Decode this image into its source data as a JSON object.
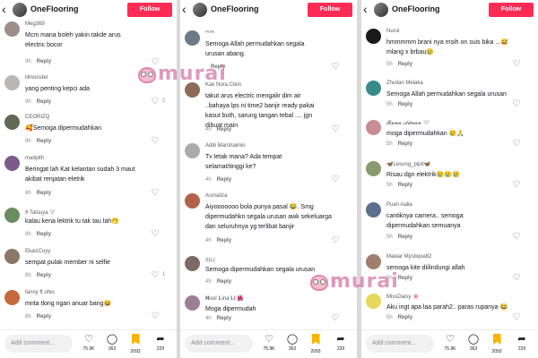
{
  "colors": {
    "follow_bg": "#fe2c55",
    "bookmark": "#f7b500",
    "watermark": "#d279a6"
  },
  "icons": {
    "back": "chevron-left-icon",
    "like": "heart-icon",
    "share": "share-icon",
    "save": "bookmark-icon",
    "comment": "comment-icon"
  },
  "watermark_text": "murai",
  "panels": [
    {
      "header": {
        "back": "‹",
        "name": "OneFlooring",
        "follow": "Follow"
      },
      "comments": [
        {
          "user": "Meg369",
          "text": "Mcm mana boleh yakin takde arus electric bocor",
          "time": "9h",
          "reply": "Reply",
          "likes": "",
          "avatar": "#9c8f8a"
        },
        {
          "user": "lilmonster",
          "text": "yang penting kepci ada",
          "time": "9h",
          "reply": "Reply",
          "likes": "2",
          "avatar": "#b9b7b5"
        },
        {
          "user": "CEORIZQ",
          "text": "🥰Semoga dipermudahkan",
          "time": "9h",
          "reply": "Reply",
          "likes": "",
          "avatar": "#5f6b54"
        },
        {
          "user": "madyith",
          "text": "Beringat lah Kat kelantan sudah 3 maut akibat renjatan eletrik",
          "time": "8h",
          "reply": "Reply",
          "likes": "",
          "avatar": "#7a5b8a"
        },
        {
          "user": "ϑ Tatsuya ツ",
          "text": "kalau kena lektrik tu tak tau lah🤭",
          "time": "8h",
          "reply": "Reply",
          "likes": "",
          "avatar": "#6a8c5e"
        },
        {
          "user": "EkaizCuyy",
          "text": "sempat pulak member ni selfie",
          "time": "8h",
          "reply": "Reply",
          "likes": "1",
          "avatar": "#8a7766"
        },
        {
          "user": "fanny ft ohio",
          "text": "mnta tlong ngan anuar bang😆",
          "time": "8h",
          "reply": "Reply",
          "likes": "",
          "avatar": "#c56a3c"
        }
      ],
      "bottom": {
        "add": "Add comment...",
        "likes": "75.9K",
        "comments": "363",
        "saves": "2093",
        "shares": "229"
      }
    },
    {
      "header": {
        "back": "‹",
        "name": "OneFlooring",
        "follow": "Follow"
      },
      "comments": [
        {
          "user": "ᵐᵘᵘᵘ",
          "text": "Semoga Allah permudahkan segala urusan abang.",
          "time": "",
          "reply": "Reply",
          "likes": "",
          "avatar": "#6d7a86"
        },
        {
          "user": "Kak Nora Cikin",
          "text": "takut arus electric mengalir dim air ..bahaya lps ni time2 banjir ready pakai kasut buth, sarung tangan tebal .... jgn dibuat main",
          "time": "4h",
          "reply": "Reply",
          "likes": "",
          "avatar": "#8c6c55"
        },
        {
          "user": "Adib Marshaimin",
          "text": "Tv letak mana? Ada tempat selamat/tinggi ke?",
          "time": "4h",
          "reply": "Reply",
          "likes": "",
          "avatar": "#aaaaaa"
        },
        {
          "user": "Asmaliza",
          "text": "Aiyooooooo bola punya pasal 😂. Smg dipermudahkn segala urusan awk sekeluarga dan seluruhnya yg terlibat banjir",
          "time": "4h",
          "reply": "Reply",
          "likes": "",
          "avatar": "#b0634a"
        },
        {
          "user": "하니",
          "text": "Semoga dipermudahkan segala urusan",
          "time": "4h",
          "reply": "Reply",
          "likes": "",
          "avatar": "#7b6a66"
        },
        {
          "user": "𝐍oor 𝐋ina 𝐋𝐥 🌺",
          "text": "Moga dipermudah",
          "time": "4h",
          "reply": "Reply",
          "likes": "",
          "avatar": "#9b7f94"
        }
      ],
      "bottom": {
        "add": "Add comment...",
        "likes": "75.9K",
        "comments": "363",
        "saves": "2093",
        "shares": "229"
      }
    },
    {
      "header": {
        "back": "‹",
        "name": "OneFlooring",
        "follow": "Follow"
      },
      "comments": [
        {
          "user": "Nurul",
          "text": "hmmmmm brani nya msih on suis bika ...😅 mlang x brbau😢",
          "time": "5h",
          "reply": "Reply",
          "likes": "",
          "avatar": "#1a1a1a"
        },
        {
          "user": "Zhulian Melaka",
          "text": "Semoga Allah permudahkan segala urusan",
          "time": "5h",
          "reply": "Reply",
          "likes": "",
          "avatar": "#3a8a8a"
        },
        {
          "user": "𝓡𝓪𝓷𝓪 𝓐𝓭𝓷𝓪𝓷 🤍",
          "text": "moga dipermudahkan 😢🙏",
          "time": "5h",
          "reply": "Reply",
          "likes": "",
          "avatar": "#c98b94"
        },
        {
          "user": "🦋Lesung_pipit🦋",
          "text": "Risau dgn elektrik😢😢😢",
          "time": "5h",
          "reply": "Reply",
          "likes": "",
          "avatar": "#8a9a6e"
        },
        {
          "user": "Puan Aalia",
          "text": "cantiknya camera.. semoga dipermudahkan semuanya",
          "time": "5h",
          "reply": "Reply",
          "likes": "",
          "avatar": "#5b6f8f"
        },
        {
          "user": "Mawar Mystique82",
          "text": "semoga kite diilindungi allah",
          "time": "5h",
          "reply": "Reply",
          "likes": "",
          "avatar": "#a07f6e"
        },
        {
          "user": "MissDaisy 🌸",
          "text": "Aku ingt apa laa parah2.. paras rupanya 😂",
          "time": "5h",
          "reply": "Reply",
          "likes": "",
          "avatar": "#e5d85a"
        }
      ],
      "bottom": {
        "add": "Add comment...",
        "likes": "75.9K",
        "comments": "363",
        "saves": "2093",
        "shares": "229"
      }
    }
  ]
}
